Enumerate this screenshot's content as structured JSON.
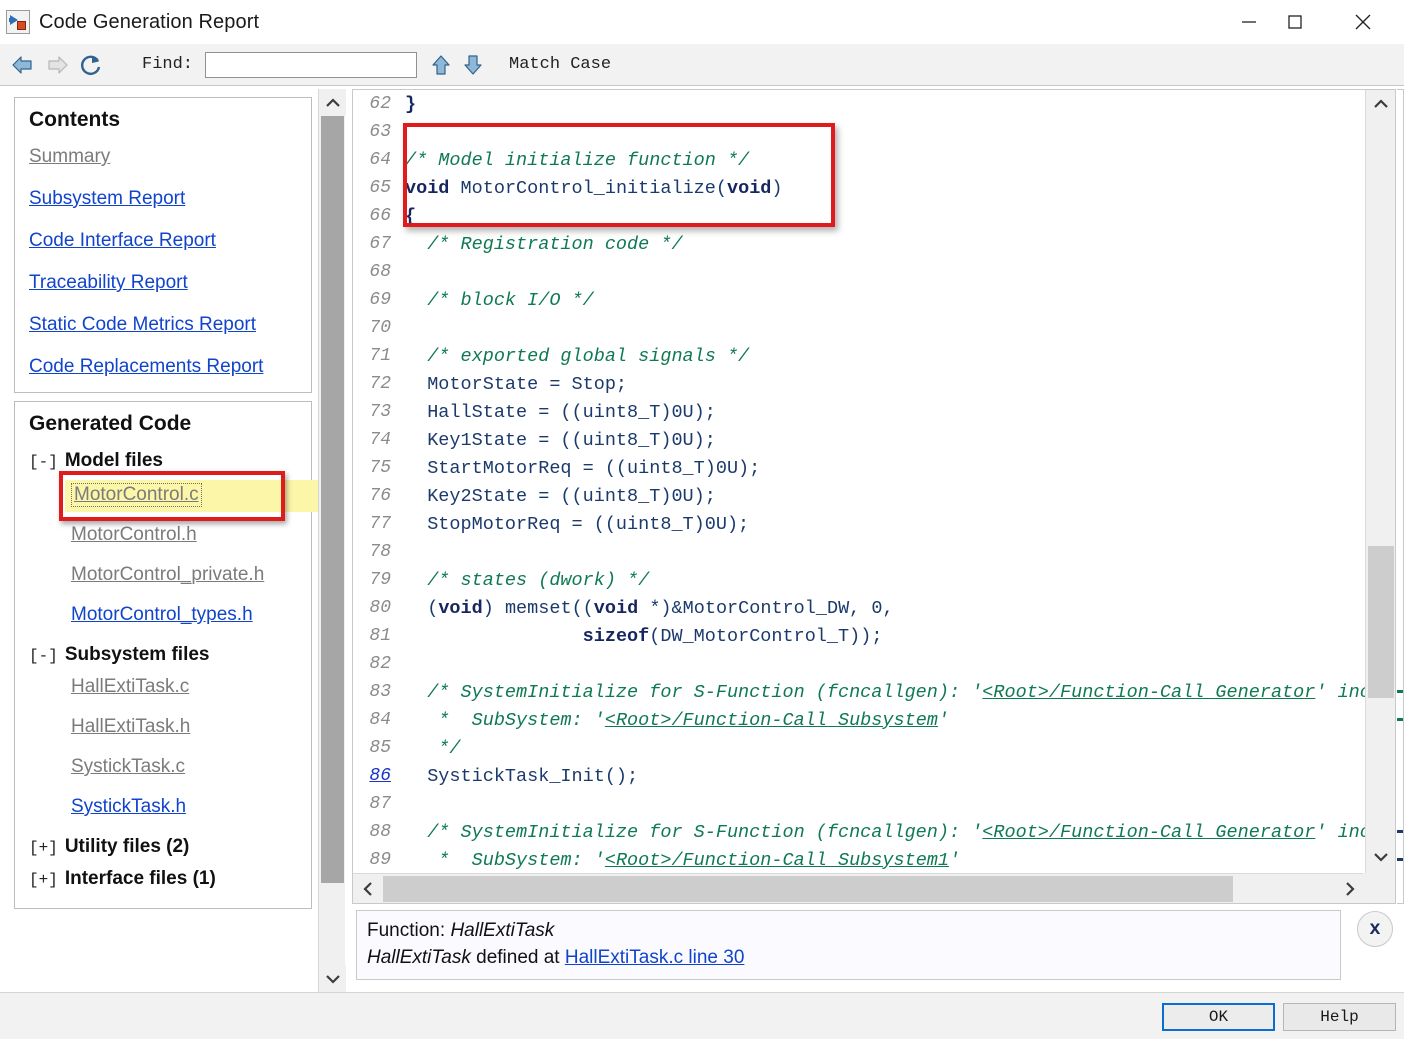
{
  "window": {
    "title": "Code Generation Report",
    "icon": "simulink-model-icon",
    "minimize": "minimize-icon",
    "maximize": "maximize-icon",
    "close": "close-icon"
  },
  "toolbar": {
    "back": "back-arrow-icon",
    "forward": "forward-arrow-icon",
    "refresh": "refresh-icon",
    "find_label": "Find:",
    "find_value": "",
    "find_placeholder": "",
    "find_up": "find-previous-icon",
    "find_down": "find-next-icon",
    "match_case_label": "Match Case"
  },
  "contents": {
    "title": "Contents",
    "links": [
      {
        "label": "Summary",
        "visited": true
      },
      {
        "label": "Subsystem Report",
        "visited": false
      },
      {
        "label": "Code Interface Report",
        "visited": false
      },
      {
        "label": "Traceability Report",
        "visited": false
      },
      {
        "label": "Static Code Metrics Report",
        "visited": false
      },
      {
        "label": "Code Replacements Report",
        "visited": false
      }
    ]
  },
  "generated_code": {
    "title": "Generated Code",
    "groups": [
      {
        "toggle": "[-]",
        "label": "Model files",
        "files": [
          {
            "label": "MotorControl.c",
            "visited": true,
            "highlighted": true
          },
          {
            "label": "MotorControl.h",
            "visited": true,
            "highlighted": false
          },
          {
            "label": "MotorControl_private.h",
            "visited": true,
            "highlighted": false
          },
          {
            "label": "MotorControl_types.h",
            "visited": false,
            "highlighted": false
          }
        ]
      },
      {
        "toggle": "[-]",
        "label": "Subsystem files",
        "files": [
          {
            "label": "HallExtiTask.c",
            "visited": true,
            "highlighted": false
          },
          {
            "label": "HallExtiTask.h",
            "visited": true,
            "highlighted": false
          },
          {
            "label": "SystickTask.c",
            "visited": true,
            "highlighted": false
          },
          {
            "label": "SystickTask.h",
            "visited": false,
            "highlighted": false
          }
        ]
      },
      {
        "toggle": "[+]",
        "label": "Utility files (2)",
        "files": []
      },
      {
        "toggle": "[+]",
        "label": "Interface files (1)",
        "files": []
      }
    ]
  },
  "code_view": {
    "file": "MotorControl.c",
    "lines": [
      {
        "no": "62",
        "no_link": false,
        "text": "}"
      },
      {
        "no": "63",
        "no_link": false,
        "text": ""
      },
      {
        "no": "64",
        "no_link": false,
        "text": "/* Model initialize function */"
      },
      {
        "no": "65",
        "no_link": false,
        "text": "void MotorControl_initialize(void)"
      },
      {
        "no": "66",
        "no_link": false,
        "text": "{"
      },
      {
        "no": "67",
        "no_link": false,
        "text": "  /* Registration code */"
      },
      {
        "no": "68",
        "no_link": false,
        "text": ""
      },
      {
        "no": "69",
        "no_link": false,
        "text": "  /* block I/O */"
      },
      {
        "no": "70",
        "no_link": false,
        "text": ""
      },
      {
        "no": "71",
        "no_link": false,
        "text": "  /* exported global signals */"
      },
      {
        "no": "72",
        "no_link": false,
        "text": "  MotorState = Stop;"
      },
      {
        "no": "73",
        "no_link": false,
        "text": "  HallState = ((uint8_T)0U);"
      },
      {
        "no": "74",
        "no_link": false,
        "text": "  Key1State = ((uint8_T)0U);"
      },
      {
        "no": "75",
        "no_link": false,
        "text": "  StartMotorReq = ((uint8_T)0U);"
      },
      {
        "no": "76",
        "no_link": false,
        "text": "  Key2State = ((uint8_T)0U);"
      },
      {
        "no": "77",
        "no_link": false,
        "text": "  StopMotorReq = ((uint8_T)0U);"
      },
      {
        "no": "78",
        "no_link": false,
        "text": ""
      },
      {
        "no": "79",
        "no_link": false,
        "text": "  /* states (dwork) */"
      },
      {
        "no": "80",
        "no_link": false,
        "text": "  (void) memset((void *)&MotorControl_DW, 0,"
      },
      {
        "no": "81",
        "no_link": false,
        "text": "                sizeof(DW_MotorControl_T));"
      },
      {
        "no": "82",
        "no_link": false,
        "text": ""
      },
      {
        "no": "83",
        "no_link": false,
        "text": "  /* SystemInitialize for S-Function (fcncallgen): '<Root>/Function-Call Generator' inc"
      },
      {
        "no": "84",
        "no_link": false,
        "text": "   *  SubSystem: '<Root>/Function-Call Subsystem'"
      },
      {
        "no": "85",
        "no_link": false,
        "text": "   */"
      },
      {
        "no": "86",
        "no_link": true,
        "text": "  SystickTask_Init();"
      },
      {
        "no": "87",
        "no_link": false,
        "text": ""
      },
      {
        "no": "88",
        "no_link": false,
        "text": "  /* SystemInitialize for S-Function (fcncallgen): '<Root>/Function-Call Generator' inc"
      },
      {
        "no": "89",
        "no_link": false,
        "text": "   *  SubSystem: '<Root>/Function-Call Subsystem1'"
      }
    ],
    "inline_links": [
      "<Root>/Function-Call Generator",
      "<Root>/Function-Call Subsystem",
      "<Root>/Function-Call Subsystem1"
    ]
  },
  "info_panel": {
    "line1_label": "Function:",
    "line1_value": "HallExtiTask",
    "line2_subject": "HallExtiTask",
    "line2_middle": "defined at",
    "line2_link": "HallExtiTask.c line 30",
    "close_label": "x"
  },
  "footer": {
    "ok_label": "OK",
    "help_label": "Help"
  },
  "colors": {
    "link": "#1144cc",
    "visited_link": "#7b7b7b",
    "comment_green": "#0f7a52",
    "keyword_navy": "#16265e",
    "identifier": "#1b3a6b",
    "annotation_red": "#e01b1b",
    "highlight_yellow": "#fbf6a8",
    "focus_blue": "#0a6ed1"
  }
}
